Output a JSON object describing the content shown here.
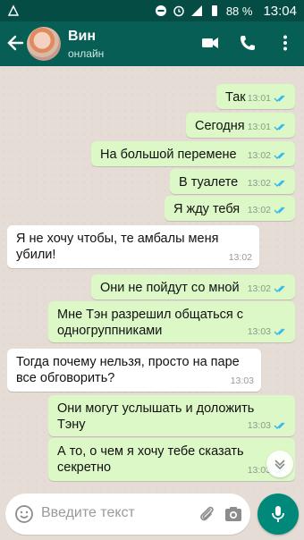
{
  "status_bar": {
    "battery": "88 %",
    "time": "13:04"
  },
  "header": {
    "name": "Вин",
    "status": "онлайн"
  },
  "messages": [
    {
      "direction": "out",
      "text": "Так",
      "time": "13:01"
    },
    {
      "direction": "out",
      "text": "Сегодня",
      "time": "13:01"
    },
    {
      "direction": "out",
      "text": "На большой перемене",
      "time": "13:02"
    },
    {
      "direction": "out",
      "text": "В туалете",
      "time": "13:02"
    },
    {
      "direction": "out",
      "text": "Я жду тебя",
      "time": "13:02"
    },
    {
      "direction": "in",
      "text": "Я не хочу чтобы, те амбалы меня убили!",
      "time": "13:02"
    },
    {
      "direction": "out",
      "text": "Они не пойдут со мной",
      "time": "13:02"
    },
    {
      "direction": "out",
      "text": "Мне Тэн разрешил общаться с одногруппниками",
      "time": "13:03"
    },
    {
      "direction": "in",
      "text": "Тогда почему нельзя, просто на паре все обговорить?",
      "time": "13:03"
    },
    {
      "direction": "out",
      "text": "Они могут услышать и доложить Тэну",
      "time": "13:03"
    },
    {
      "direction": "out",
      "text": "А то, о чем я хочу тебе сказать секретно",
      "time": "13:03"
    }
  ],
  "composer": {
    "placeholder": "Введите текст"
  },
  "colors": {
    "header": "#075e54",
    "outgoing_bubble": "#dcf8c6",
    "incoming_bubble": "#ffffff",
    "read_ticks": "#34b7f1",
    "fab": "#00897b"
  }
}
